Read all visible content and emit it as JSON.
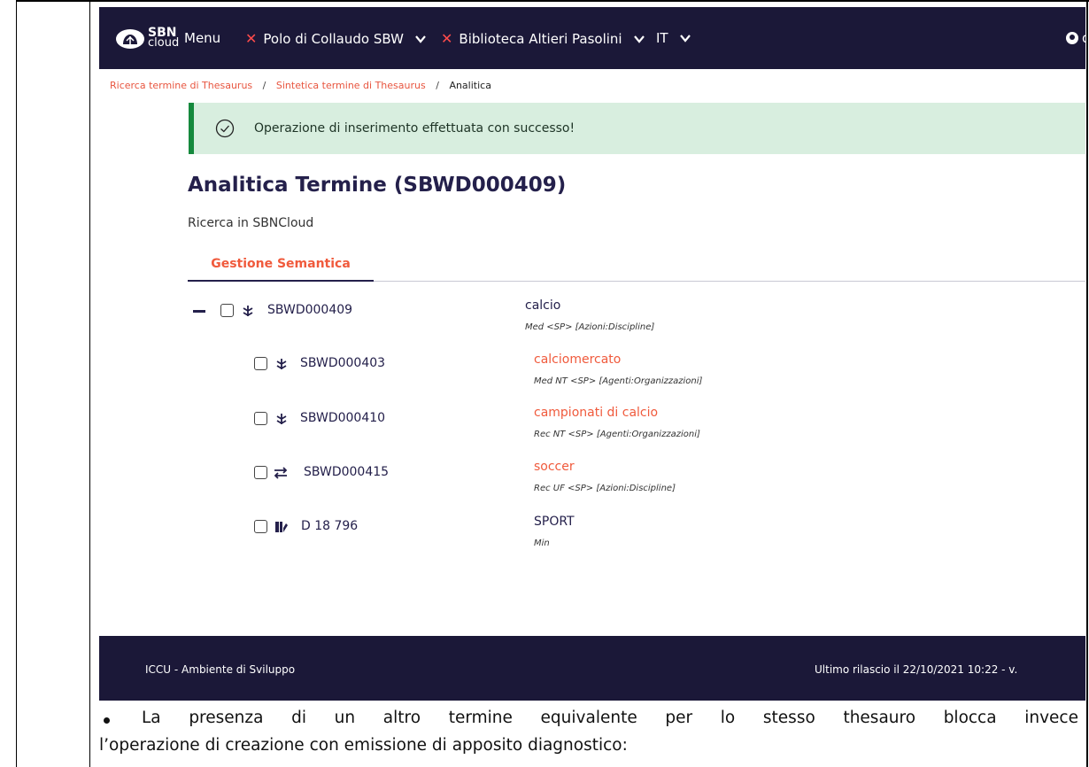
{
  "navbar": {
    "logo_line1": "SBN",
    "logo_line2": "cloud",
    "menu_label": "Menu",
    "polo_label": "Polo di Collaudo SBW",
    "biblioteca_label": "Biblioteca Altieri Pasolini",
    "language_label": "IT",
    "user_label": "d"
  },
  "breadcrumb": {
    "item1": "Ricerca termine di Thesaurus",
    "item2": "Sintetica termine di Thesaurus",
    "current": "Analitica",
    "separator": "/"
  },
  "alert": {
    "message": "Operazione di inserimento effettuata con successo!"
  },
  "page": {
    "title": "Analitica Termine (SBWD000409)",
    "subtitle": "Ricerca in SBNCloud",
    "tab_active": "Gestione Semantica"
  },
  "tree": {
    "root": {
      "code": "SBWD000409",
      "term": "calcio",
      "meta": "Med <SP> [Azioni:Discipline]",
      "icon": "descriptor-icon"
    },
    "children": [
      {
        "code": "SBWD000403",
        "term": "calciomercato",
        "meta": "Med NT <SP> [Agenti:Organizzazioni]",
        "icon": "descriptor-icon"
      },
      {
        "code": "SBWD000410",
        "term": "campionati di calcio",
        "meta": "Rec NT <SP> [Agenti:Organizzazioni]",
        "icon": "descriptor-icon"
      },
      {
        "code": "SBWD000415",
        "term": "soccer",
        "meta": "Rec UF <SP> [Azioni:Discipline]",
        "icon": "exchange-icon"
      },
      {
        "code": "D 18 796",
        "term": "SPORT",
        "meta": "Min",
        "icon": "classification-icon"
      }
    ]
  },
  "footer": {
    "left": "ICCU - Ambiente di Sviluppo",
    "right": "Ultimo rilascio il 22/10/2021 10:22 - v."
  },
  "document": {
    "bullet_line1": "La presenza di un altro termine equivalente per lo stesso thesauro blocca invece",
    "line2": "l’operazione di creazione con emissione di apposito diagnostico:"
  },
  "colors": {
    "navbar": "#1b1838",
    "accent": "#f05a3c",
    "success_bg": "#d8eedf",
    "success_border": "#15893d",
    "primary_text": "#24204b"
  }
}
